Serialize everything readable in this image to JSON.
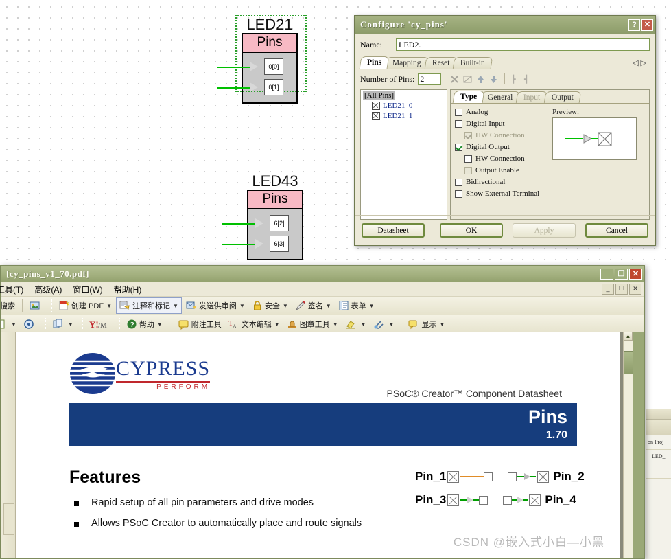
{
  "schematic": {
    "components": [
      {
        "label": "LED21",
        "title": "Pins",
        "pins": [
          "0[0]",
          "0[1]"
        ],
        "selected": true
      },
      {
        "label": "LED43",
        "title": "Pins",
        "pins": [
          "6[2]",
          "6[3]"
        ],
        "selected": false
      }
    ]
  },
  "dialog": {
    "title": "Configure 'cy_pins'",
    "help_label": "?",
    "close_label": "✕",
    "name_label": "Name:",
    "name_value": "LED2.",
    "tabs": [
      {
        "label": "Pins",
        "active": true,
        "disabled": false
      },
      {
        "label": "Mapping",
        "active": false,
        "disabled": false
      },
      {
        "label": "Reset",
        "active": false,
        "disabled": false
      },
      {
        "label": "Built-in",
        "active": false,
        "disabled": false
      }
    ],
    "tab_nav_prev": "◁",
    "tab_nav_next": "▷",
    "pin_count_label": "Number of Pins:",
    "pin_count_value": "2",
    "pin_toolbar_icons": [
      "delete-icon",
      "rename-icon",
      "move-up-icon",
      "move-down-icon",
      "expand-all-icon",
      "collapse-all-icon"
    ],
    "tree": {
      "root_label": "[All Pins]",
      "items": [
        "LED21_0",
        "LED21_1"
      ]
    },
    "inner_tabs": [
      {
        "label": "Type",
        "active": true,
        "disabled": false
      },
      {
        "label": "General",
        "active": false,
        "disabled": false
      },
      {
        "label": "Input",
        "active": false,
        "disabled": true
      },
      {
        "label": "Output",
        "active": false,
        "disabled": false
      }
    ],
    "type_options": [
      {
        "label": "Analog",
        "checked": false,
        "indent": false,
        "disabled": false
      },
      {
        "label": "Digital Input",
        "checked": false,
        "indent": false,
        "disabled": false
      },
      {
        "label": "HW Connection",
        "checked": true,
        "indent": true,
        "disabled": true
      },
      {
        "label": "Digital Output",
        "checked": true,
        "indent": false,
        "disabled": false
      },
      {
        "label": "HW Connection",
        "checked": false,
        "indent": true,
        "disabled": false
      },
      {
        "label": "Output Enable",
        "checked": false,
        "indent": true,
        "disabled": true
      },
      {
        "label": "Bidirectional",
        "checked": false,
        "indent": false,
        "disabled": false
      },
      {
        "label": "Show External Terminal",
        "checked": false,
        "indent": false,
        "disabled": false
      }
    ],
    "preview_label": "Preview:",
    "buttons": {
      "datasheet": "Datasheet",
      "ok": "OK",
      "apply": "Apply",
      "cancel": "Cancel"
    }
  },
  "pdf_window": {
    "title": "[cy_pins_v1_70.pdf]",
    "window_buttons": {
      "minimize": "_",
      "maximize": "❐",
      "close": "✕"
    },
    "mdi_buttons": {
      "minimize": "_",
      "restore": "❐",
      "close": "✕"
    },
    "menus": [
      "工具(T)",
      "高级(A)",
      "窗口(W)",
      "帮助(H)"
    ],
    "toolbar_row1": [
      {
        "label": "搜索",
        "icon": "search-icon",
        "caret": false,
        "boxed": false
      },
      {
        "label": "",
        "icon": "picture-icon",
        "caret": false,
        "boxed": false
      },
      {
        "label": "创建 PDF",
        "icon": "create-pdf-icon",
        "caret": true,
        "boxed": false
      },
      {
        "label": "注释和标记",
        "icon": "comment-markup-icon",
        "caret": true,
        "boxed": true
      },
      {
        "label": "发送供审阅",
        "icon": "send-review-icon",
        "caret": true,
        "boxed": false
      },
      {
        "label": "安全",
        "icon": "lock-icon",
        "caret": true,
        "boxed": false
      },
      {
        "label": "签名",
        "icon": "pen-icon",
        "caret": true,
        "boxed": false
      },
      {
        "label": "表单",
        "icon": "form-icon",
        "caret": true,
        "boxed": false
      }
    ],
    "toolbar_row2": [
      {
        "label": "",
        "icon": "zoom-box-icon",
        "caret": true,
        "boxed": false
      },
      {
        "label": "",
        "icon": "zoom-target-icon",
        "caret": false,
        "boxed": false
      },
      {
        "label": "",
        "icon": "page-layout-icon",
        "caret": true,
        "boxed": false
      },
      {
        "label": "",
        "icon": "yahoo-icon",
        "caret": false,
        "boxed": false
      },
      {
        "label": "帮助",
        "icon": "help-icon",
        "caret": true,
        "boxed": false
      },
      {
        "label": "附注工具",
        "icon": "note-tool-icon",
        "caret": false,
        "boxed": false
      },
      {
        "label": "文本编辑",
        "icon": "text-edit-icon",
        "caret": true,
        "boxed": false
      },
      {
        "label": "图章工具",
        "icon": "stamp-tool-icon",
        "caret": true,
        "boxed": false
      },
      {
        "label": "",
        "icon": "highlighter-icon",
        "caret": true,
        "boxed": false
      },
      {
        "label": "",
        "icon": "attach-icon",
        "caret": true,
        "boxed": false
      },
      {
        "label": "显示",
        "icon": "show-icon",
        "caret": true,
        "boxed": false
      }
    ]
  },
  "document": {
    "logo_text": "CYPRESS",
    "logo_tagline": "PERFORM",
    "datasheet_label": "PSoC® Creator™ Component Datasheet",
    "band_title": "Pins",
    "band_version": "1.70",
    "features_heading": "Features",
    "features": [
      "Rapid setup of all pin parameters and drive modes",
      "Allows PSoC Creator to automatically place and route signals"
    ],
    "pin_diagram": [
      {
        "left": "Pin_1",
        "right": "Pin_2"
      },
      {
        "left": "Pin_3",
        "right": "Pin_4"
      }
    ]
  },
  "edge_panel": {
    "rows": [
      "on Proj",
      "LED_"
    ]
  },
  "watermark": "CSDN @嵌入式小白—小黑",
  "colors": {
    "dialog_titlebar": "#9aa877",
    "component_title": "#f7b9c4",
    "band_blue": "#163d7d",
    "cypress_red": "#c0282d",
    "wire_green": "#00c000"
  }
}
